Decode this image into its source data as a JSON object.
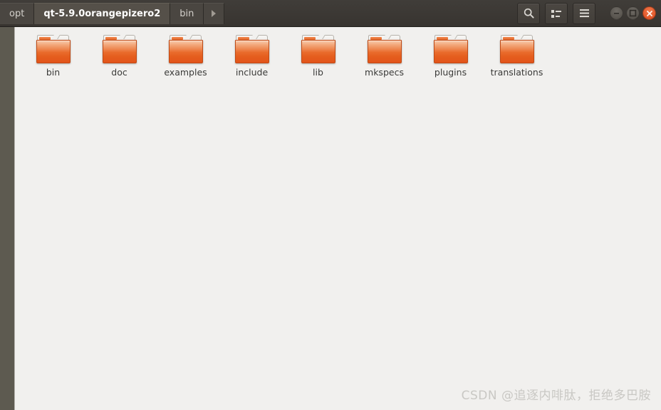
{
  "window": {
    "titlebar_bg": "#3c3834",
    "content_bg": "#f1f0ee",
    "sidebar_bg": "#5d5a50",
    "accent": "#e2541a"
  },
  "breadcrumb": {
    "items": [
      {
        "label": "opt",
        "active": false
      },
      {
        "label": "qt-5.9.0orangepizero2",
        "active": true
      },
      {
        "label": "bin",
        "active": false
      }
    ],
    "next_arrow_icon": "chevron-right-icon"
  },
  "toolbar": {
    "buttons": [
      {
        "name": "search-button",
        "icon": "search-icon",
        "label": "Search"
      },
      {
        "name": "view-toggle-button",
        "icon": "list-view-icon",
        "label": "View options"
      },
      {
        "name": "menu-button",
        "icon": "hamburger-menu-icon",
        "label": "Menu"
      }
    ]
  },
  "window_controls": [
    {
      "name": "minimize-button",
      "icon": "minimize-icon",
      "label": "Minimize"
    },
    {
      "name": "maximize-button",
      "icon": "maximize-icon",
      "label": "Maximize"
    },
    {
      "name": "close-button",
      "icon": "close-icon",
      "label": "Close"
    }
  ],
  "files": {
    "items": [
      {
        "name": "bin",
        "type": "folder",
        "icon": "folder-icon"
      },
      {
        "name": "doc",
        "type": "folder",
        "icon": "folder-icon"
      },
      {
        "name": "examples",
        "type": "folder",
        "icon": "folder-icon"
      },
      {
        "name": "include",
        "type": "folder",
        "icon": "folder-icon"
      },
      {
        "name": "lib",
        "type": "folder",
        "icon": "folder-icon"
      },
      {
        "name": "mkspecs",
        "type": "folder",
        "icon": "folder-icon"
      },
      {
        "name": "plugins",
        "type": "folder",
        "icon": "folder-icon"
      },
      {
        "name": "translations",
        "type": "folder",
        "icon": "folder-icon"
      }
    ]
  },
  "watermark": {
    "text": "CSDN @追逐内啡肽，拒绝多巴胺"
  }
}
